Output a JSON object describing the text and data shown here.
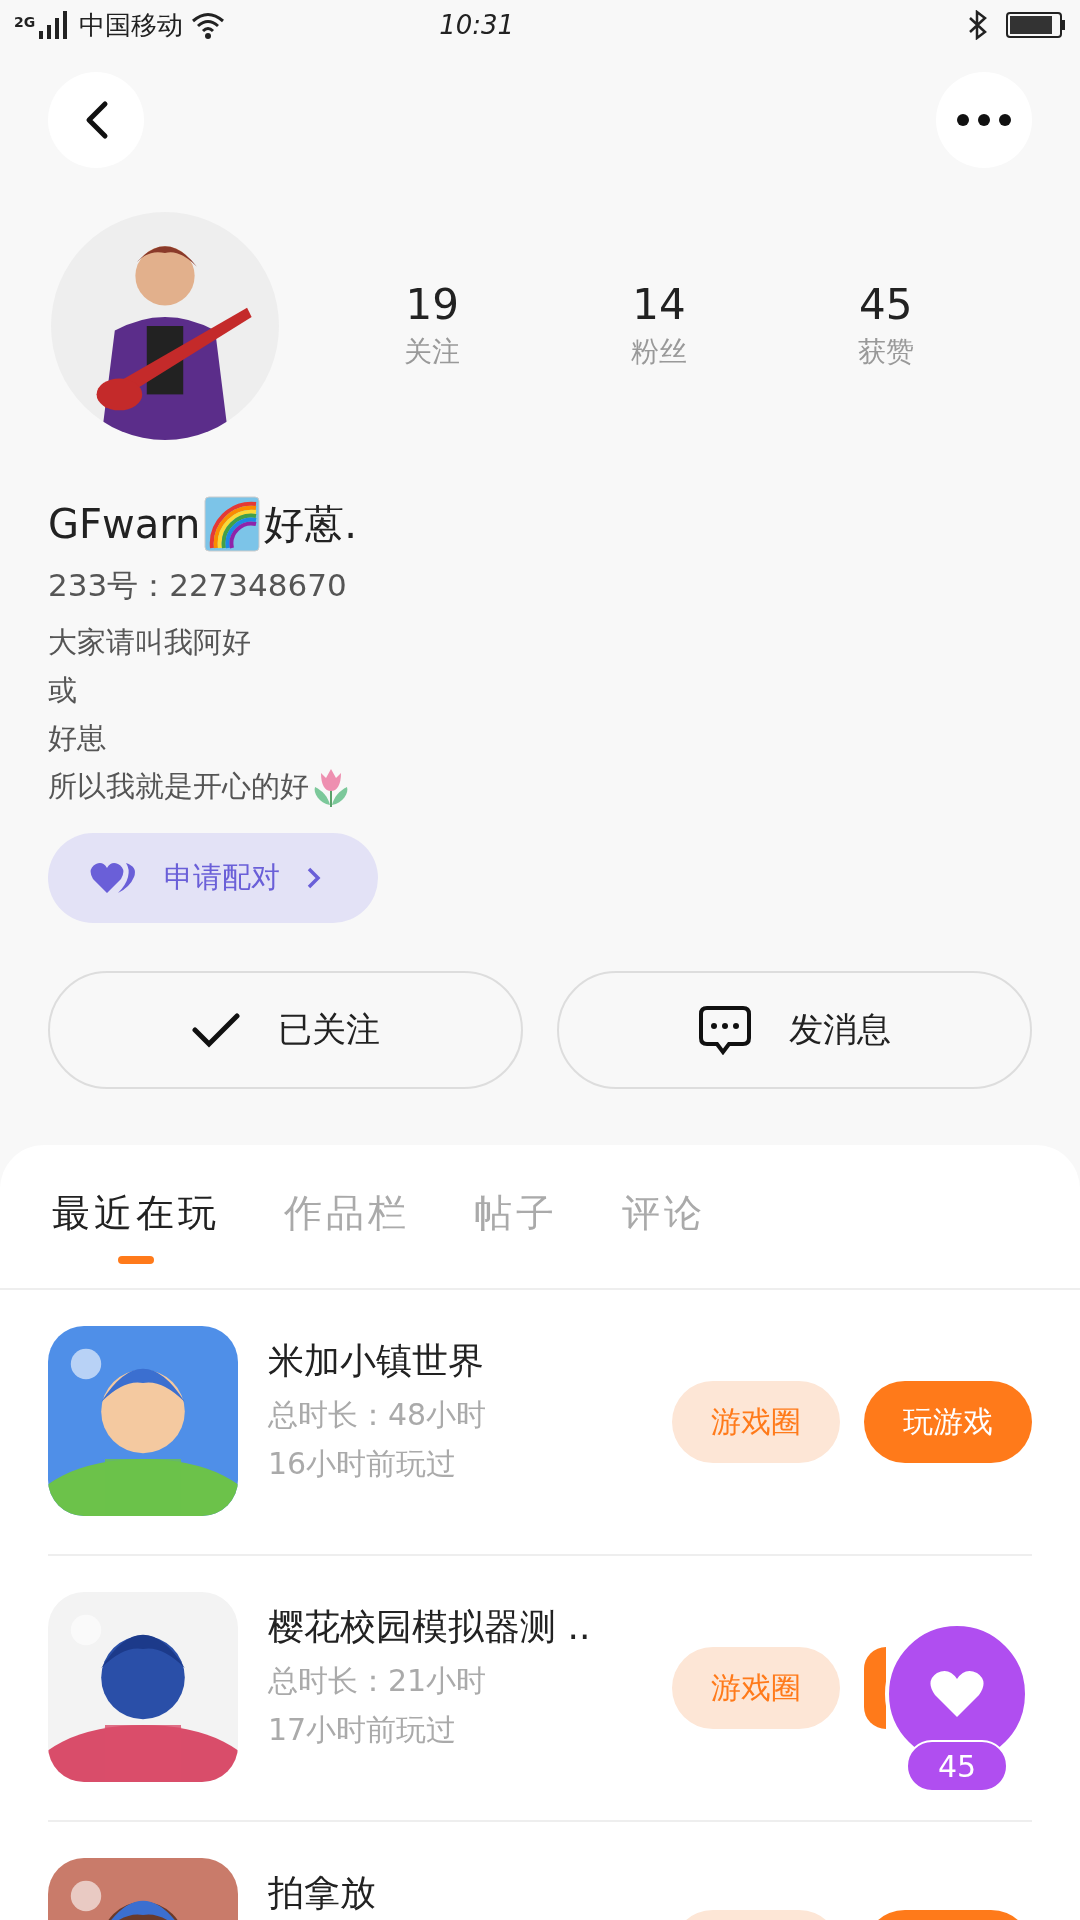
{
  "status_bar": {
    "network": "2G",
    "carrier": "中国移动",
    "time": "10:31"
  },
  "profile": {
    "stats": [
      {
        "value": "19",
        "label": "关注"
      },
      {
        "value": "14",
        "label": "粉丝"
      },
      {
        "value": "45",
        "label": "获赞"
      }
    ],
    "name": [
      {
        "kind": "text",
        "text": "GFwarn"
      },
      {
        "kind": "rainbow"
      },
      {
        "kind": "text",
        "text": "好蒽."
      }
    ],
    "id": "233号：227348670",
    "bio": [
      {
        "text": "大家请叫我阿好"
      },
      {
        "text": "或"
      },
      {
        "text": "好崽"
      },
      {
        "text": "所以我就是开心的好",
        "kind": "flower"
      }
    ],
    "pair_button": "申请配对"
  },
  "actions": [
    {
      "kind": "follow",
      "label": "已关注"
    },
    {
      "kind": "message",
      "label": "发消息"
    }
  ],
  "tabs": [
    {
      "label": "最近在玩",
      "selected": true
    },
    {
      "label": "作品栏",
      "selected": false
    },
    {
      "label": "帖子",
      "selected": false
    },
    {
      "label": "评论",
      "selected": false
    }
  ],
  "games": [
    {
      "title": "米加小镇世界",
      "duration": "总时长：48小时",
      "last_played": "16小时前玩过",
      "circle_label": "游戏圈",
      "play_label": "玩游戏"
    },
    {
      "title": "樱花校园模拟器测 ..",
      "duration": "总时长：21小时",
      "last_played": "17小时前玩过",
      "circle_label": "游戏圈"
    },
    {
      "title": "拍拿放"
    }
  ],
  "floating_like": {
    "count": "45"
  }
}
